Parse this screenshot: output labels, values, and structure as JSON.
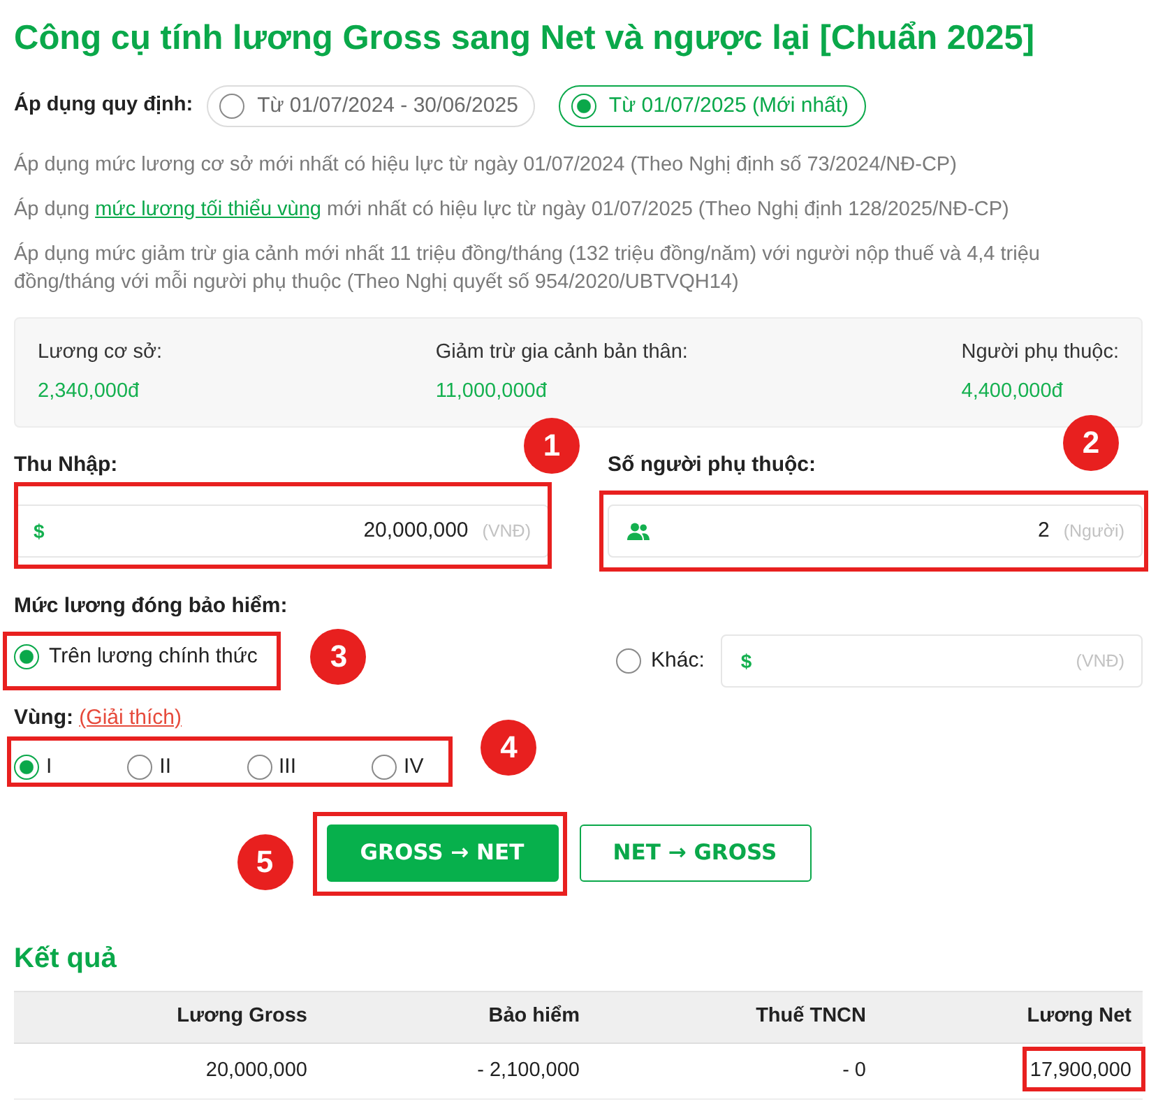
{
  "title": "Công cụ tính lương Gross sang Net và ngược lại [Chuẩn 2025]",
  "regulation": {
    "label": "Áp dụng quy định:",
    "options": [
      {
        "label": "Từ 01/07/2024 - 30/06/2025",
        "selected": false
      },
      {
        "label": "Từ 01/07/2025 (Mới nhất)",
        "selected": true
      }
    ]
  },
  "notes": [
    {
      "parts": [
        {
          "kind": "text",
          "text": "Áp dụng mức lương cơ sở mới nhất có hiệu lực từ ngày 01/07/2024 (Theo Nghị định số 73/2024/NĐ-CP)"
        }
      ]
    },
    {
      "parts": [
        {
          "kind": "text",
          "text": "Áp dụng "
        },
        {
          "kind": "link",
          "text": "mức lương tối thiểu vùng"
        },
        {
          "kind": "text",
          "text": " mới nhất có hiệu lực từ ngày 01/07/2025 (Theo Nghị định 128/2025/NĐ-CP)"
        }
      ]
    },
    {
      "parts": [
        {
          "kind": "text",
          "text": "Áp dụng mức giảm trừ gia cảnh mới nhất 11 triệu đồng/tháng (132 triệu đồng/năm) với người nộp thuế và 4,4 triệu đồng/tháng với mỗi người phụ thuộc (Theo Nghị quyết số 954/2020/UBTVQH14)"
        }
      ]
    }
  ],
  "summary": [
    {
      "label": "Lương cơ sở:",
      "value": "2,340,000đ"
    },
    {
      "label": "Giảm trừ gia cảnh bản thân:",
      "value": "11,000,000đ"
    },
    {
      "label": "Người phụ thuộc:",
      "value": "4,400,000đ"
    }
  ],
  "income": {
    "label": "Thu Nhập:",
    "icon": "$",
    "value": "20,000,000",
    "unit": "(VNĐ)",
    "highlighted": true,
    "callout": "1"
  },
  "dependents": {
    "label": "Số người phụ thuộc:",
    "value": "2",
    "unit": "(Người)",
    "highlighted": true,
    "callout": "2"
  },
  "insurance": {
    "label": "Mức lương đóng bảo hiểm:",
    "options": [
      {
        "kind": "radio",
        "label": "Trên lương chính thức",
        "selected": true,
        "highlighted": true,
        "callout": "3"
      },
      {
        "kind": "amount",
        "label": "Khác:",
        "selected": false,
        "icon": "$",
        "unit": "(VNĐ)",
        "highlighted": false
      }
    ]
  },
  "region": {
    "label": "Vùng:",
    "link": "(Giải thích)",
    "options": [
      {
        "label": "I",
        "selected": true
      },
      {
        "label": "II",
        "selected": false
      },
      {
        "label": "III",
        "selected": false
      },
      {
        "label": "IV",
        "selected": false
      }
    ],
    "highlighted": true,
    "callout": "4"
  },
  "actions": [
    {
      "label": "GROSS → NET",
      "selected": true,
      "highlighted": true,
      "callout": "5"
    },
    {
      "label": "NET → GROSS",
      "selected": false,
      "highlighted": false
    }
  ],
  "result": {
    "title": "Kết quả",
    "columns": [
      "Lương Gross",
      "Bảo hiểm",
      "Thuế TNCN",
      "Lương Net"
    ],
    "rows": [
      [
        {
          "text": "20,000,000",
          "highlighted": false
        },
        {
          "text": "- 2,100,000",
          "highlighted": false
        },
        {
          "text": "- 0",
          "highlighted": false
        },
        {
          "text": "17,900,000",
          "highlighted": true
        }
      ]
    ]
  }
}
